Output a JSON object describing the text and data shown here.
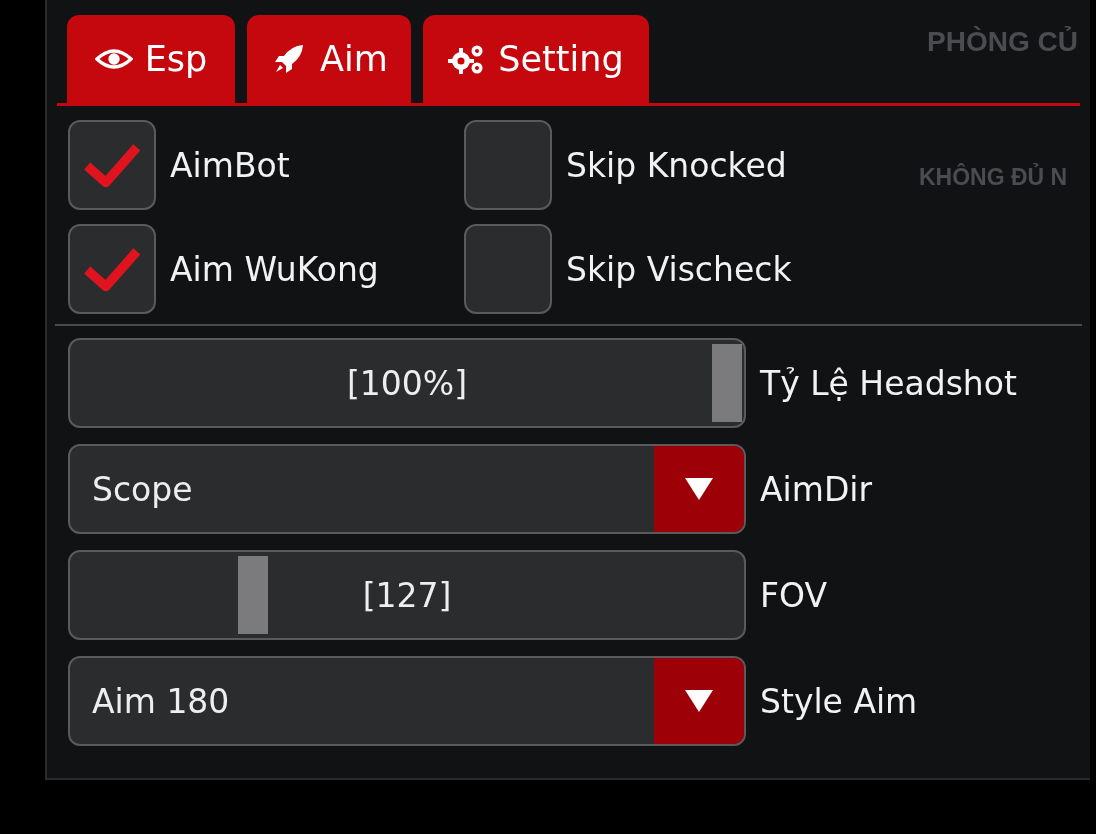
{
  "background_texts": [
    "PHÒNG CỦ",
    "KHÔNG ĐỦ N"
  ],
  "tabs": [
    {
      "label": "Esp"
    },
    {
      "label": "Aim"
    },
    {
      "label": "Setting"
    }
  ],
  "checkboxes": [
    {
      "label": "AimBot",
      "checked": true
    },
    {
      "label": "Skip Knocked",
      "checked": false
    },
    {
      "label": "Aim WuKong",
      "checked": true
    },
    {
      "label": "Skip Vischeck",
      "checked": false
    }
  ],
  "controls": [
    {
      "kind": "slider",
      "value": "[100%]",
      "level": 1.0,
      "label": "Tỷ Lệ Headshot"
    },
    {
      "kind": "combo",
      "value": "Scope",
      "label": "AimDir"
    },
    {
      "kind": "slider",
      "value": "[127]",
      "level": 0.26,
      "label": "FOV"
    },
    {
      "kind": "combo",
      "value": "Aim 180",
      "label": "Style Aim"
    }
  ]
}
